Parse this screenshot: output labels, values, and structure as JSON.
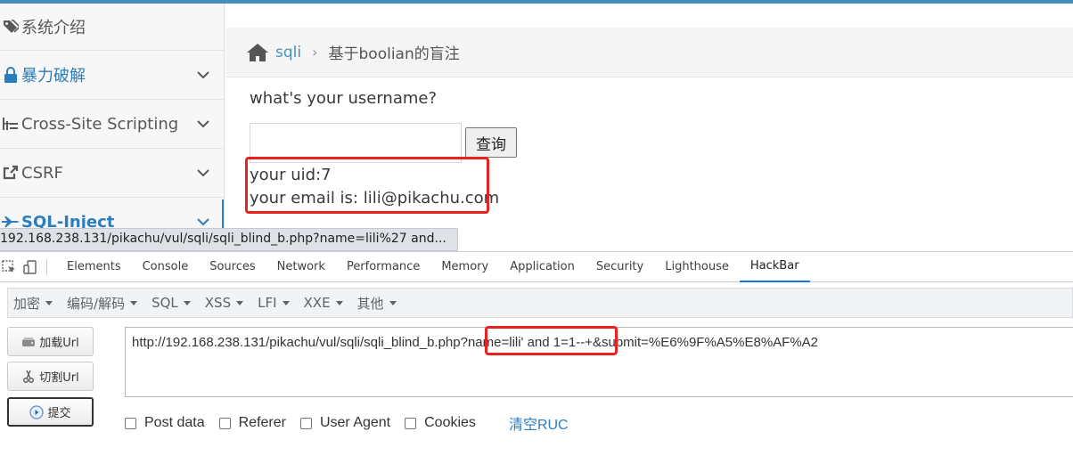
{
  "sidebar": {
    "items": [
      {
        "label": "系统介绍",
        "icon": "tags-icon"
      },
      {
        "label": "暴力破解",
        "icon": "lock-icon"
      },
      {
        "label": "Cross-Site Scripting",
        "icon": "sitemap-icon"
      },
      {
        "label": "CSRF",
        "icon": "share-square-icon"
      },
      {
        "label": "SQL-Inject",
        "icon": "fighter-jet-icon"
      }
    ]
  },
  "breadcrumb": {
    "home_icon": "home-icon",
    "link": "sqli",
    "separator": "›",
    "current": "基于boolian的盲注"
  },
  "form": {
    "question": "what's your username?",
    "input_value": "",
    "query_button": "查询",
    "result_line1": "your uid:7",
    "result_line2": "your email is: lili@pikachu.com"
  },
  "statusbar": {
    "url": "192.168.238.131/pikachu/vul/sqli/sqli_blind_b.php?name=lili%27 and..."
  },
  "devtools": {
    "tabs": [
      "Elements",
      "Console",
      "Sources",
      "Network",
      "Performance",
      "Memory",
      "Application",
      "Security",
      "Lighthouse",
      "HackBar"
    ],
    "active_tab": "HackBar"
  },
  "hackbar": {
    "menu": [
      "加密",
      "编码/解码",
      "SQL",
      "XSS",
      "LFI",
      "XXE",
      "其他"
    ],
    "load_button": "加载Url",
    "split_button": "切割Url",
    "execute_button": "提交",
    "url": "http://192.168.238.131/pikachu/vul/sqli/sqli_blind_b.php?name=lili' and 1=1--+&submit=%E6%9F%A5%E8%AF%A2",
    "options": [
      "Post data",
      "Referer",
      "User Agent",
      "Cookies"
    ],
    "clear_link": "清空RUC"
  },
  "colors": {
    "accent": "#438eb9",
    "link": "#2b7dbc",
    "highlight": "#e8231f"
  }
}
